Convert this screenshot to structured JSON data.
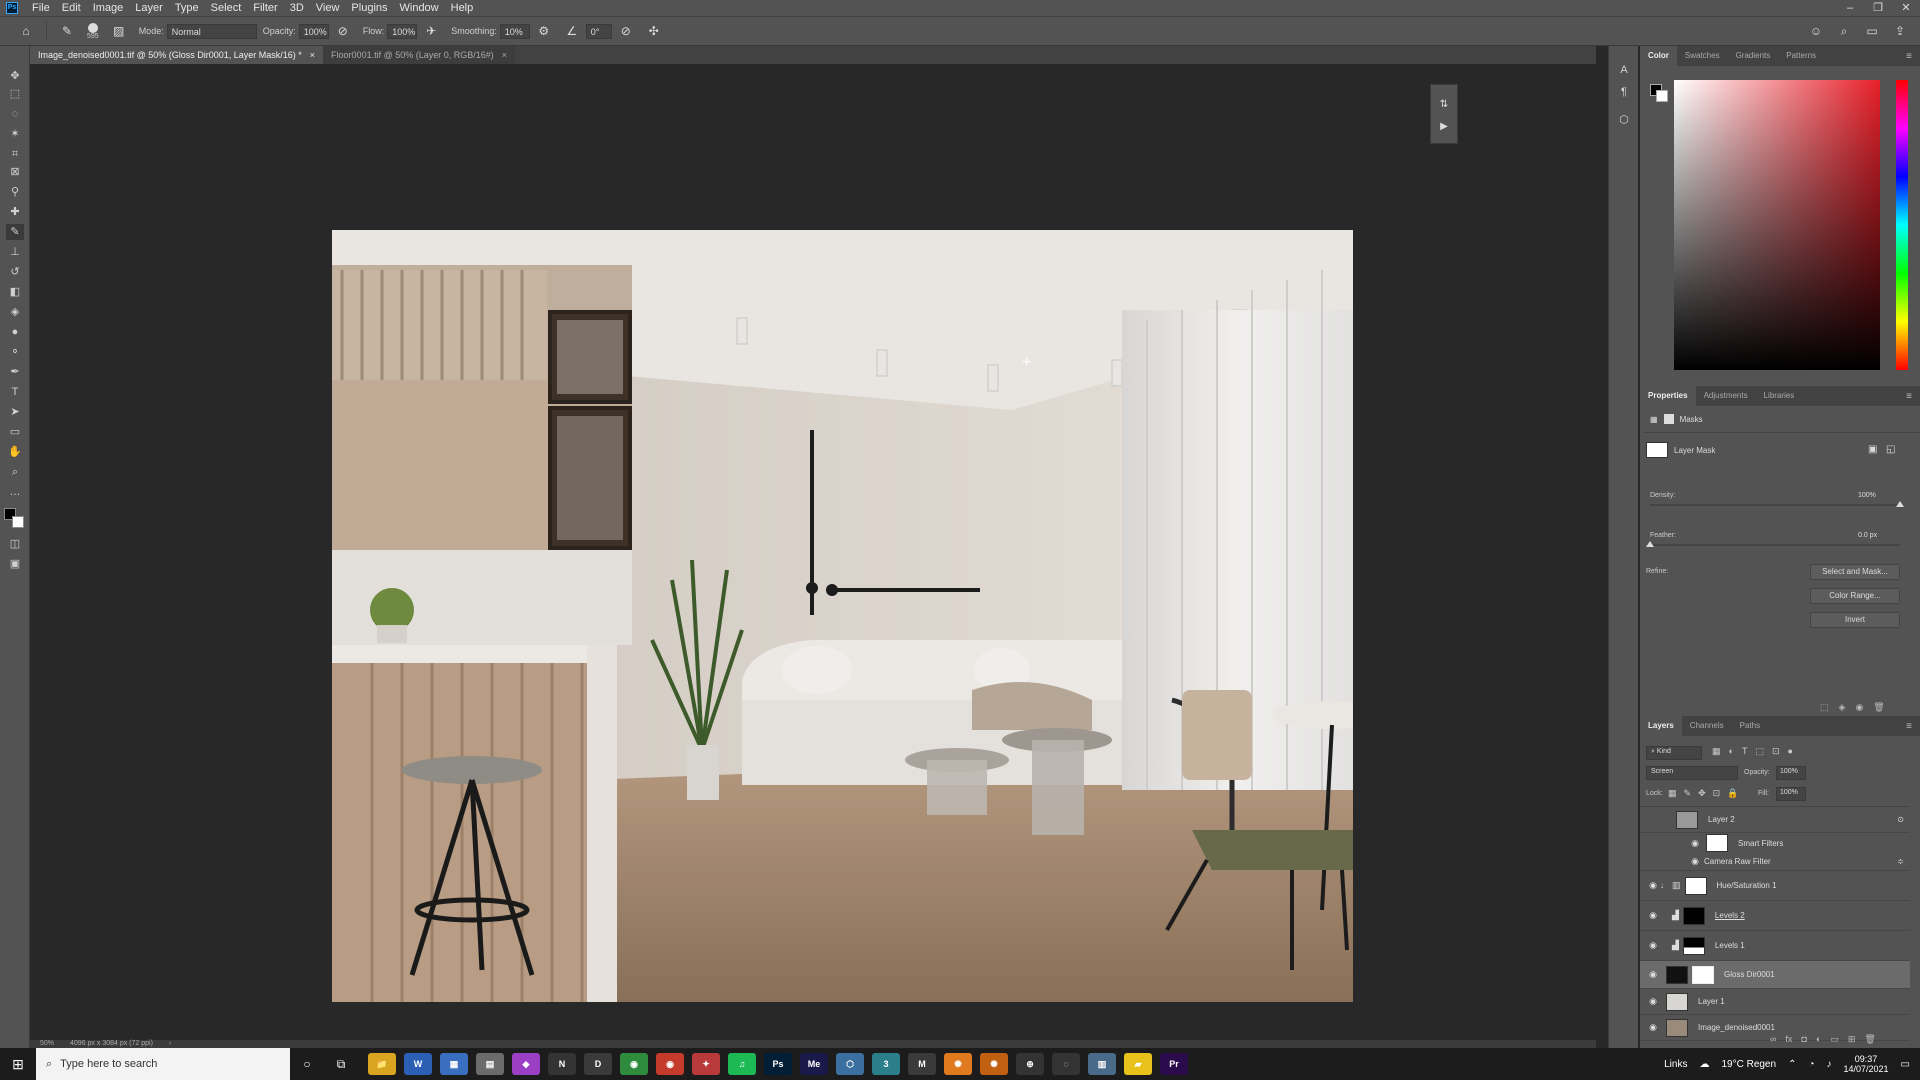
{
  "menubar": {
    "items": [
      "File",
      "Edit",
      "Image",
      "Layer",
      "Type",
      "Select",
      "Filter",
      "3D",
      "View",
      "Plugins",
      "Window",
      "Help"
    ],
    "logo": "Ps"
  },
  "options": {
    "brush_size": "595",
    "mode_label": "Mode:",
    "mode_value": "Normal",
    "opacity_label": "Opacity:",
    "opacity_value": "100%",
    "flow_label": "Flow:",
    "flow_value": "100%",
    "smoothing_label": "Smoothing:",
    "smoothing_value": "10%",
    "angle_value": "0°"
  },
  "tabs": [
    {
      "label": "Image_denoised0001.tif @ 50% (Gloss Dir0001, Layer Mask/16) *",
      "close": "×"
    },
    {
      "label": "Floor0001.tif @ 50% (Layer 0, RGB/16#)",
      "close": "×"
    }
  ],
  "status": {
    "zoom": "50%",
    "doc_info": "4096 px x 3084 px (72 ppi)",
    "arrow": "›"
  },
  "color_panel": {
    "tabs": [
      "Color",
      "Swatches",
      "Gradients",
      "Patterns"
    ],
    "hue_color": "#e8202a"
  },
  "properties": {
    "tabs": [
      "Properties",
      "Adjustments",
      "Libraries"
    ],
    "masks_label": "Masks",
    "layer_mask_label": "Layer Mask",
    "density_label": "Density:",
    "density_value": "100%",
    "density_level": 1.0,
    "feather_label": "Feather:",
    "feather_value": "0.0 px",
    "feather_level": 0.0,
    "refine_label": "Refine:",
    "select_mask_button": "Select and Mask...",
    "color_range_button": "Color Range...",
    "invert_button": "Invert"
  },
  "layers_panel": {
    "tabs": [
      "Layers",
      "Channels",
      "Paths"
    ],
    "kind_label": "Kind",
    "blend_mode": "Screen",
    "opacity_label": "Opacity:",
    "opacity_value": "100%",
    "lock_label": "Lock:",
    "fill_label": "Fill:",
    "fill_value": "100%",
    "layers": [
      {
        "name": "Layer 2",
        "visible": false
      },
      {
        "name": "Smart Filters",
        "visible": false
      },
      {
        "name": "Camera Raw Filter",
        "visible": false
      },
      {
        "name": "Hue/Saturation 1",
        "visible": true
      },
      {
        "name": "Levels 2",
        "visible": true
      },
      {
        "name": "Levels 1",
        "visible": true
      },
      {
        "name": "Gloss Dir0001",
        "visible": true
      },
      {
        "name": "Layer 1",
        "visible": true
      },
      {
        "name": "Image_denoised0001",
        "visible": true
      }
    ]
  },
  "taskbar": {
    "search_placeholder": "Type here to search",
    "links_label": "Links",
    "weather": "19°C Regen",
    "time": "09:37",
    "date": "14/07/2021",
    "apps": [
      {
        "label": "📁",
        "color": "#d9a520"
      },
      {
        "label": "W",
        "color": "#2b5fb4"
      },
      {
        "label": "▦",
        "color": "#3a6fbf"
      },
      {
        "label": "▤",
        "color": "#6b6b6b"
      },
      {
        "label": "◆",
        "color": "#9b3fc4"
      },
      {
        "label": "N",
        "color": "#333333"
      },
      {
        "label": "D",
        "color": "#3a3a3a"
      },
      {
        "label": "◉",
        "color": "#2e8b3e"
      },
      {
        "label": "◉",
        "color": "#c43b2b"
      },
      {
        "label": "✦",
        "color": "#b93a3a"
      },
      {
        "label": "♫",
        "color": "#1db954"
      },
      {
        "label": "Ps",
        "color": "#001e36"
      },
      {
        "label": "Me",
        "color": "#1a1a4a"
      },
      {
        "label": "⬡",
        "color": "#3a6fa0"
      },
      {
        "label": "3",
        "color": "#2a7f8a"
      },
      {
        "label": "M",
        "color": "#3a3a3a"
      },
      {
        "label": "✺",
        "color": "#e07a1f"
      },
      {
        "label": "✺",
        "color": "#c06010"
      },
      {
        "label": "⊕",
        "color": "#333333"
      },
      {
        "label": "◌",
        "color": "#333333"
      },
      {
        "label": "▥",
        "color": "#4a6a8a"
      },
      {
        "label": "▰",
        "color": "#e8c21a"
      },
      {
        "label": "Pr",
        "color": "#2a0a4a"
      }
    ]
  }
}
